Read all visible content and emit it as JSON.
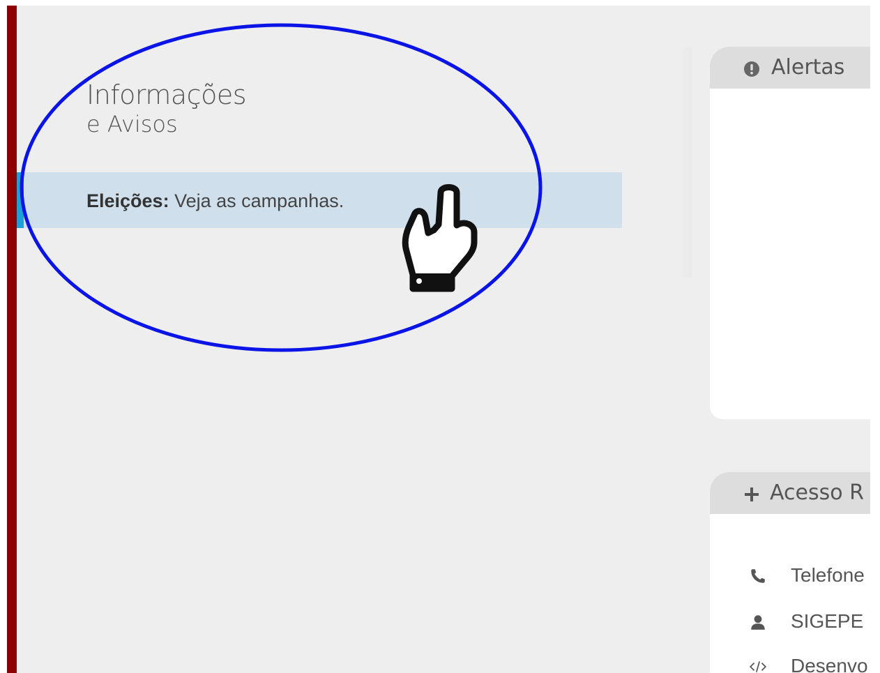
{
  "info": {
    "title_line1": "Informações",
    "title_line2": "e Avisos"
  },
  "notice": {
    "label": "Eleições:",
    "text": " Veja as campanhas."
  },
  "alerts_panel": {
    "title": "Alertas",
    "icon": "exclamation-circle-icon"
  },
  "access_panel": {
    "title": "Acesso R",
    "icon": "plus-icon",
    "items": [
      {
        "label": "Telefone",
        "icon": "phone-icon"
      },
      {
        "label": "SIGEPE",
        "icon": "user-icon"
      },
      {
        "label": "Desenvo",
        "icon": "code-icon"
      }
    ]
  },
  "colors": {
    "left_bar": "#8b0000",
    "background": "#eeeeee",
    "notice_bg": "#cfe0ec",
    "notice_accent": "#1e9fd6",
    "panel_header": "#dddddd",
    "annotation_ellipse": "#0a14e6"
  },
  "annotation": {
    "shape": "ellipse",
    "cursor": "hand-pointer-icon"
  }
}
